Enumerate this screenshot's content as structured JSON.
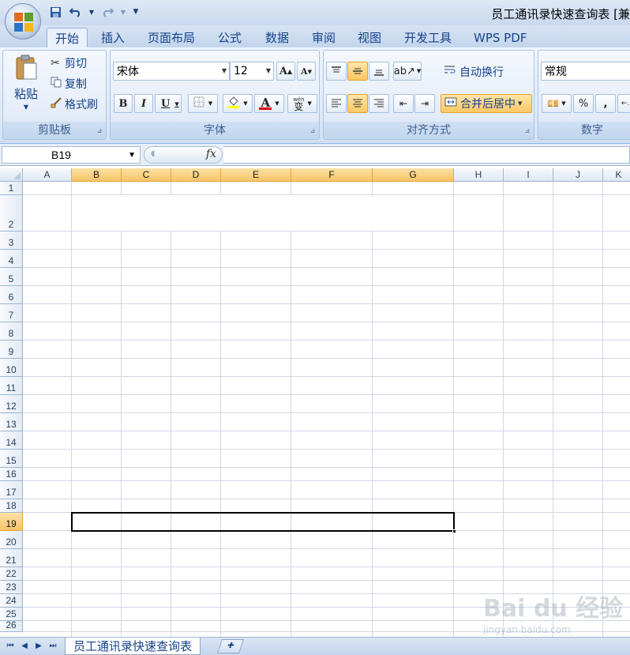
{
  "window": {
    "title": "员工通讯录快速查询表  [兼"
  },
  "qat": {
    "save_icon": "save-icon",
    "undo_icon": "undo-icon",
    "redo_icon": "redo-icon",
    "customize_icon": "chevron-down-icon"
  },
  "tabs": [
    {
      "label": "开始",
      "active": true
    },
    {
      "label": "插入"
    },
    {
      "label": "页面布局"
    },
    {
      "label": "公式"
    },
    {
      "label": "数据"
    },
    {
      "label": "审阅"
    },
    {
      "label": "视图"
    },
    {
      "label": "开发工具"
    },
    {
      "label": "WPS PDF"
    }
  ],
  "ribbon": {
    "clipboard": {
      "label": "剪贴板",
      "paste": "粘贴",
      "cut": "剪切",
      "copy": "复制",
      "format_painter": "格式刷"
    },
    "font": {
      "label": "字体",
      "font_name": "宋体",
      "font_size": "12",
      "grow": "A",
      "shrink": "A",
      "bold": "B",
      "italic": "I",
      "underline": "U",
      "font_color": "A",
      "phonetic": "wén",
      "phonetic_char": "变"
    },
    "alignment": {
      "label": "对齐方式",
      "wrap_text": "自动换行",
      "merge_center": "合并后居中"
    },
    "number": {
      "label": "数字",
      "format": "常规",
      "percent": "%",
      "comma": ","
    }
  },
  "formula_bar": {
    "name_box": "B19",
    "fx": "fx",
    "content": ""
  },
  "grid": {
    "columns": [
      "A",
      "B",
      "C",
      "D",
      "E",
      "F",
      "G",
      "H",
      "I",
      "J",
      "K"
    ],
    "selected_columns": [
      "B",
      "C",
      "D",
      "E",
      "F",
      "G"
    ],
    "rows": [
      "1",
      "2",
      "3",
      "4",
      "5",
      "6",
      "7",
      "8",
      "9",
      "10",
      "11",
      "12",
      "13",
      "14",
      "15",
      "16",
      "17",
      "18",
      "19",
      "20",
      "21",
      "22",
      "23",
      "24",
      "25",
      "26"
    ],
    "selected_row": "19",
    "active_range": "B19:G19"
  },
  "sheets": {
    "tabs": [
      "员工通讯录快速查询表"
    ],
    "active": "员工通讯录快速查询表"
  },
  "watermark": {
    "text": "Bai du 经验",
    "sub": "jingyan.baidu.com"
  },
  "colors": {
    "selection_header": "#f7c367",
    "ribbon_text": "#15428b",
    "gridline": "#d0d7e5"
  }
}
